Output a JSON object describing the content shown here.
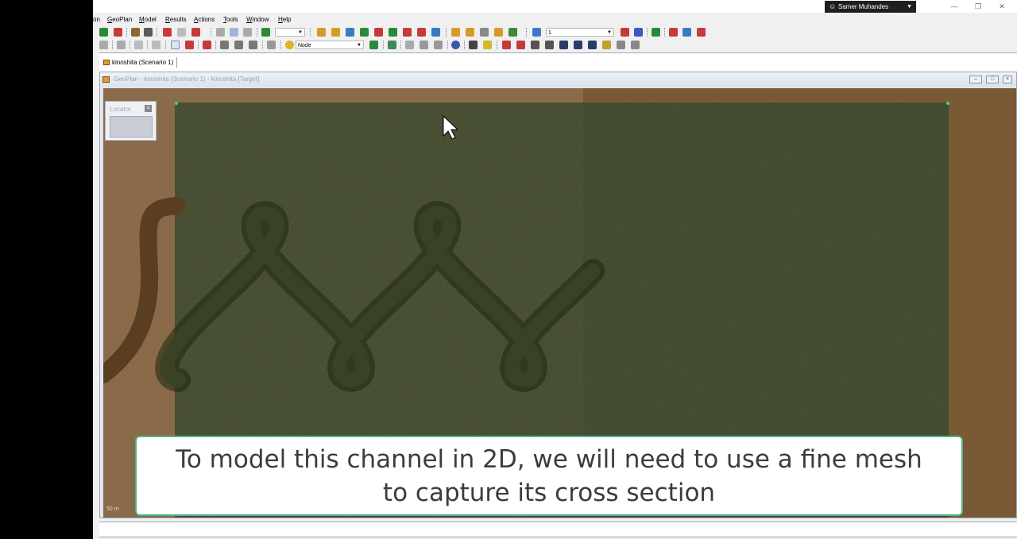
{
  "user": {
    "name": "Samer Muhandes"
  },
  "menu": [
    {
      "label": "on",
      "acc": ""
    },
    {
      "label": "GeoPlan",
      "acc": "G"
    },
    {
      "label": "Model",
      "acc": "M"
    },
    {
      "label": "Results",
      "acc": "R"
    },
    {
      "label": "Actions",
      "acc": "A"
    },
    {
      "label": "Tools",
      "acc": "T"
    },
    {
      "label": "Window",
      "acc": "W"
    },
    {
      "label": "Help",
      "acc": "H"
    }
  ],
  "toolbar": {
    "scenario_value": "1",
    "layer_select": "Node"
  },
  "document_tab": {
    "label": "kinoshita (Scenario 1)"
  },
  "child_window": {
    "title": "GeoPlan - kinoshita (Scenario 1) - kinoshita [Target]"
  },
  "locator": {
    "title": "Locator"
  },
  "map": {
    "scale_label": "50 m"
  },
  "caption": {
    "text": "To model this channel in 2D, we will need to use a fine mesh to capture its cross section"
  },
  "colors": {
    "terrain": "#7e5e3c",
    "mesh_left": "#3d4527",
    "mesh_right": "#384125",
    "channel": "#2b3119",
    "caption_border": "#4fb28a"
  }
}
